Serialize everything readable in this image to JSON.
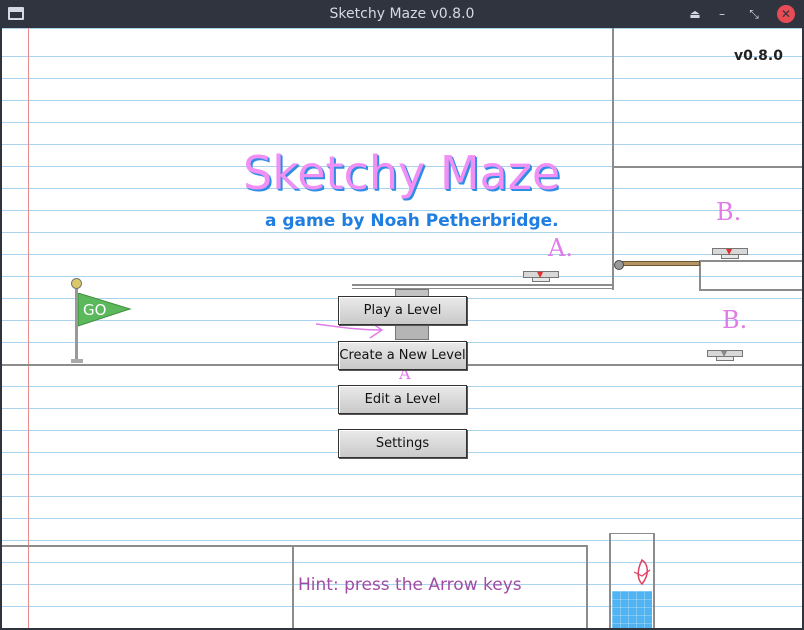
{
  "window": {
    "title": "Sketchy Maze v0.8.0",
    "controls": {
      "eject": "⏏",
      "minimize": "–",
      "restore": "⤡",
      "close": "✕"
    }
  },
  "game": {
    "version": "v0.8.0",
    "title": "Sketchy Maze",
    "byline": "a game by Noah Petherbridge.",
    "flag_text": "GO",
    "markers": {
      "a1": "A.",
      "b1": "B.",
      "b2": "B.",
      "a2": "A"
    }
  },
  "menu": {
    "play": "Play a Level",
    "create": "Create a New Level",
    "edit": "Edit a Level",
    "settings": "Settings"
  },
  "hint": "Hint: press the Arrow keys",
  "colors": {
    "title_fill": "#f090f4",
    "title_shadow": "#2e8ee6",
    "byline": "#1f7ee0",
    "hint": "#a14ca4",
    "notebook_lines": "#a9d3ee",
    "margin_line": "#e88a8a",
    "close_button": "#e74c55",
    "flag": "#5cb85c",
    "water": "#4fb4f1"
  }
}
